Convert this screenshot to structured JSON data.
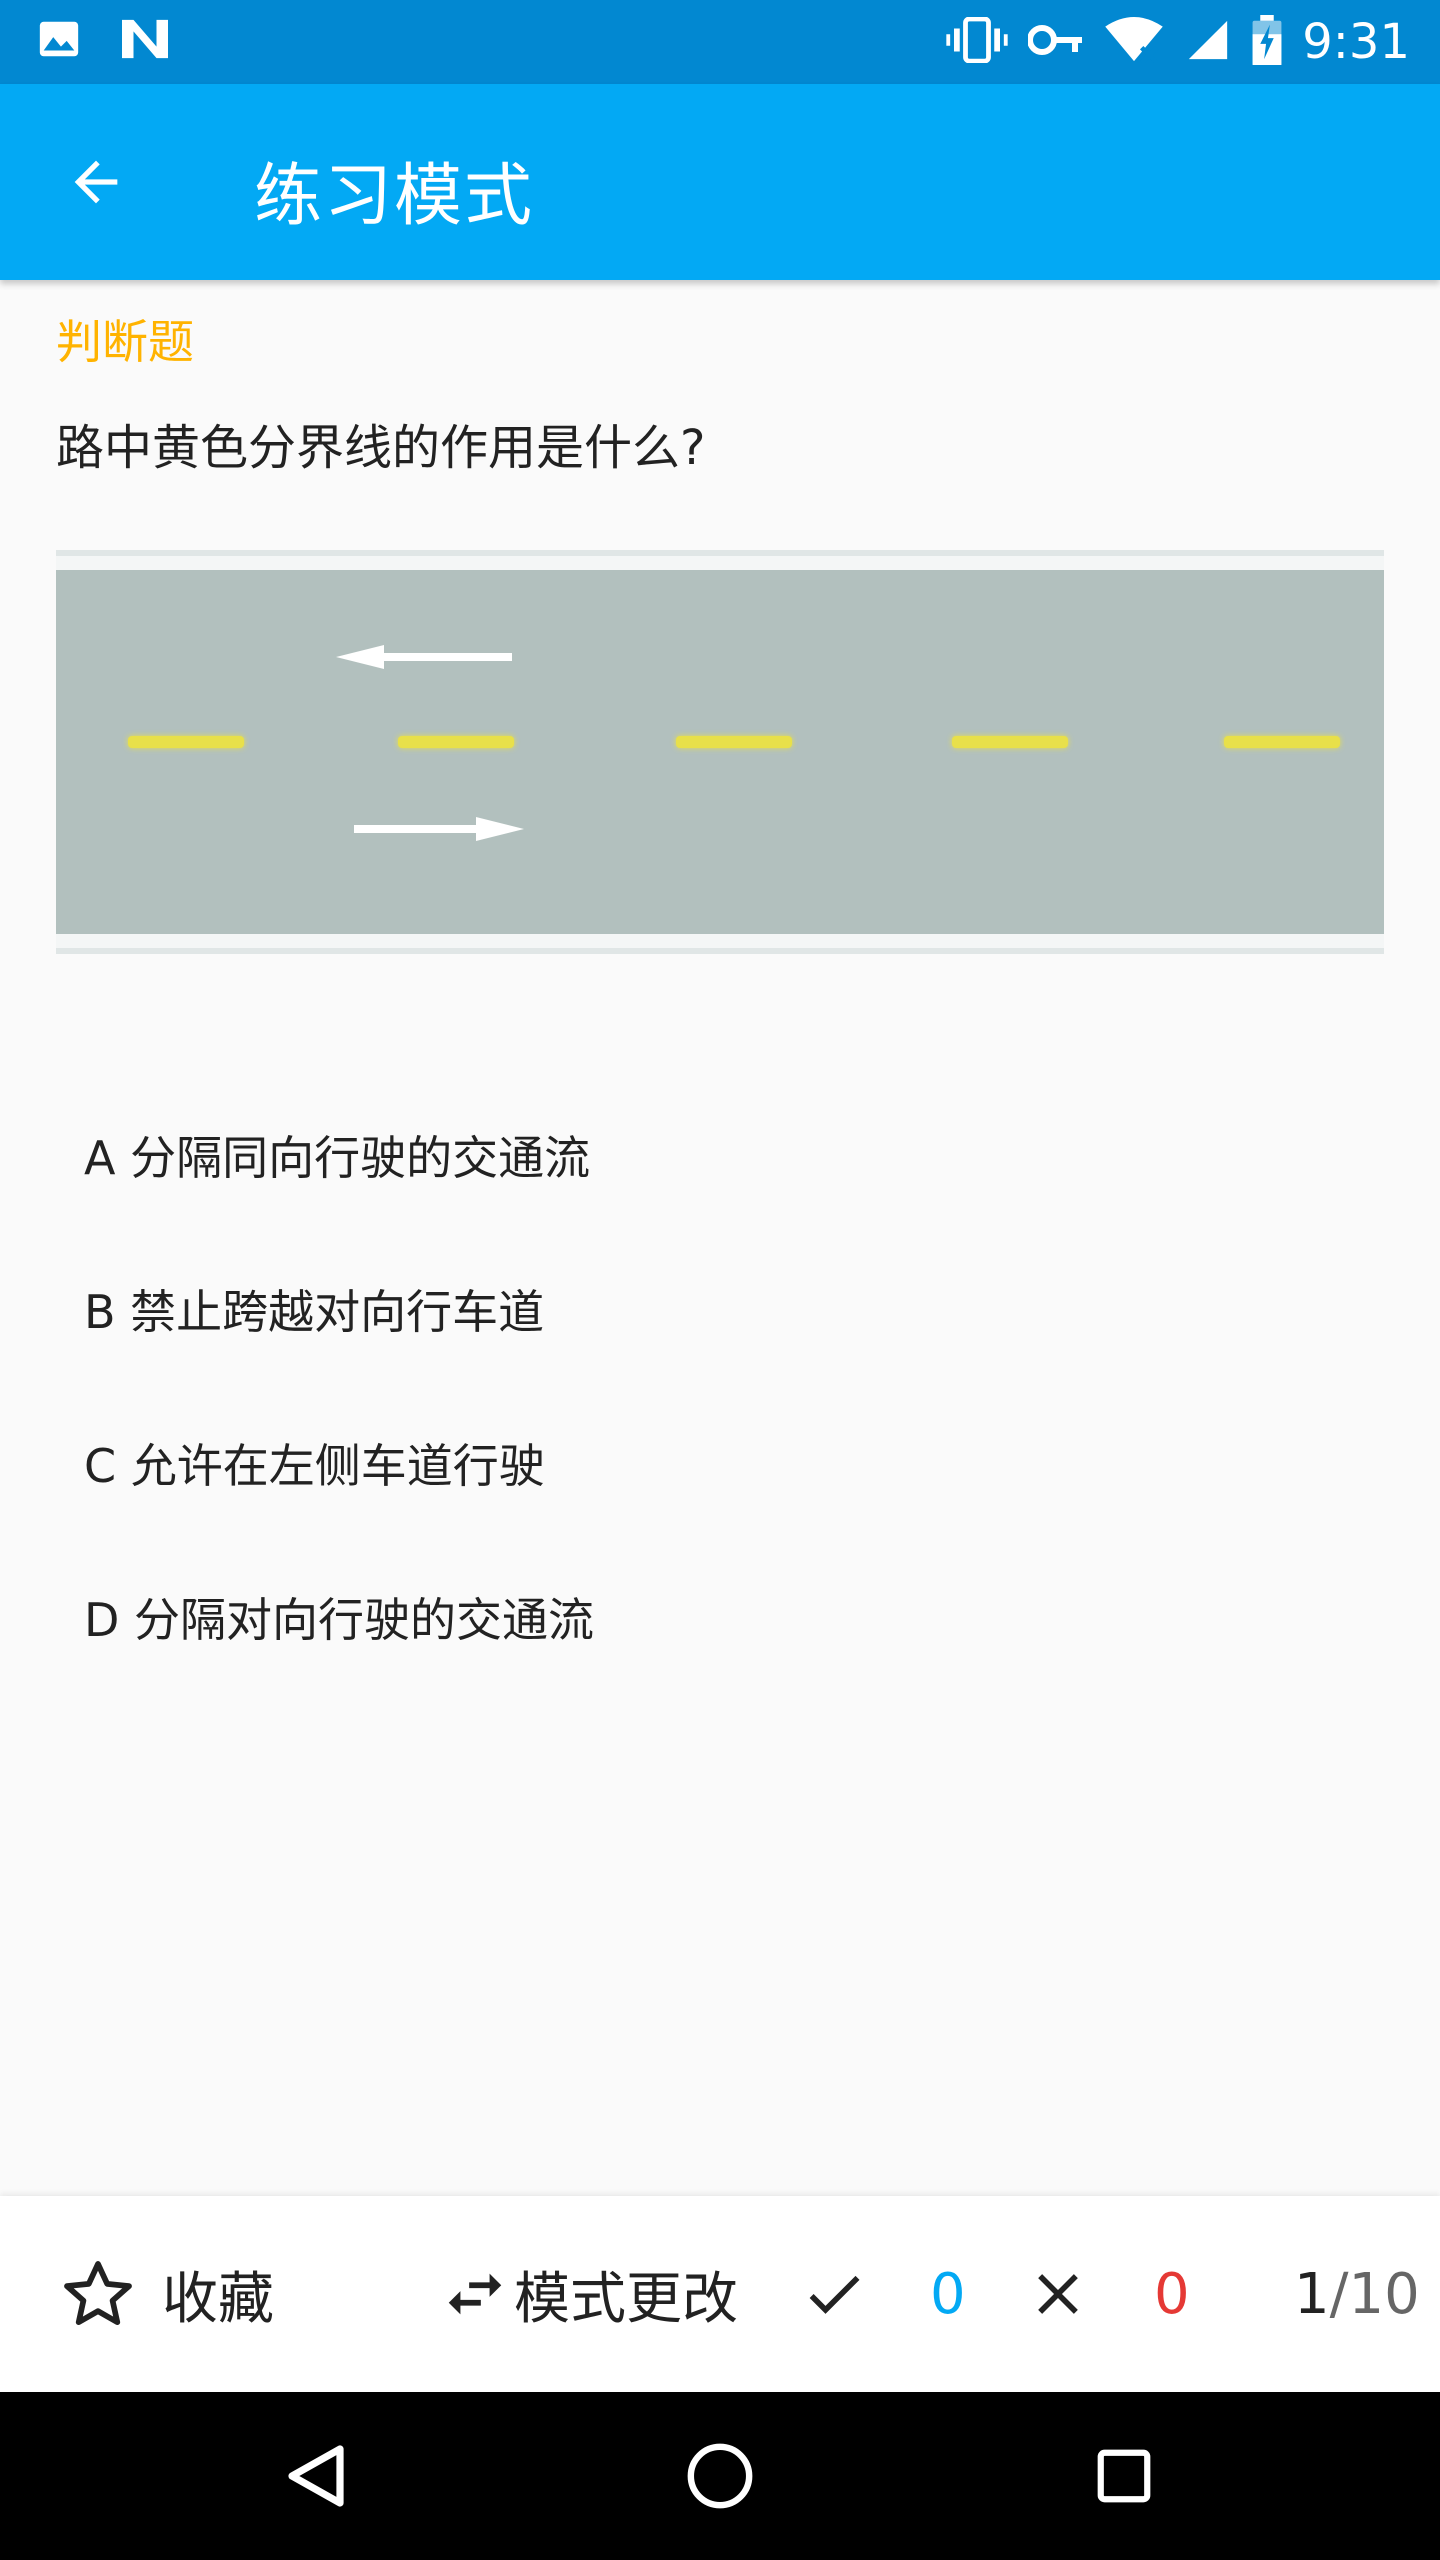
{
  "status_bar": {
    "time": "9:31",
    "icons": [
      "image-icon",
      "n-notification-icon",
      "vibrate-icon",
      "vpn-key-icon",
      "wifi-icon",
      "signal-icon",
      "battery-charging-icon"
    ]
  },
  "app_bar": {
    "title": "练习模式",
    "back_icon": "arrow-back-icon"
  },
  "question": {
    "type": "判断题",
    "text": "路中黄色分界线的作用是什么?",
    "image_description": "road-yellow-center-line-image"
  },
  "options": [
    {
      "label": "A 分隔同向行驶的交通流"
    },
    {
      "label": "B 禁止跨越对向行车道"
    },
    {
      "label": "C 允许在左侧车道行驶"
    },
    {
      "label": "D 分隔对向行驶的交通流"
    }
  ],
  "toolbar": {
    "favorite_label": "收藏",
    "mode_change_label": "模式更改",
    "correct_count": "0",
    "wrong_count": "0",
    "progress_current": "1",
    "progress_total": "/10"
  },
  "colors": {
    "status_bar": "#0288d1",
    "app_bar": "#03a9f4",
    "question_type": "#ffb300",
    "correct": "#03a9f4",
    "wrong": "#e53935"
  }
}
